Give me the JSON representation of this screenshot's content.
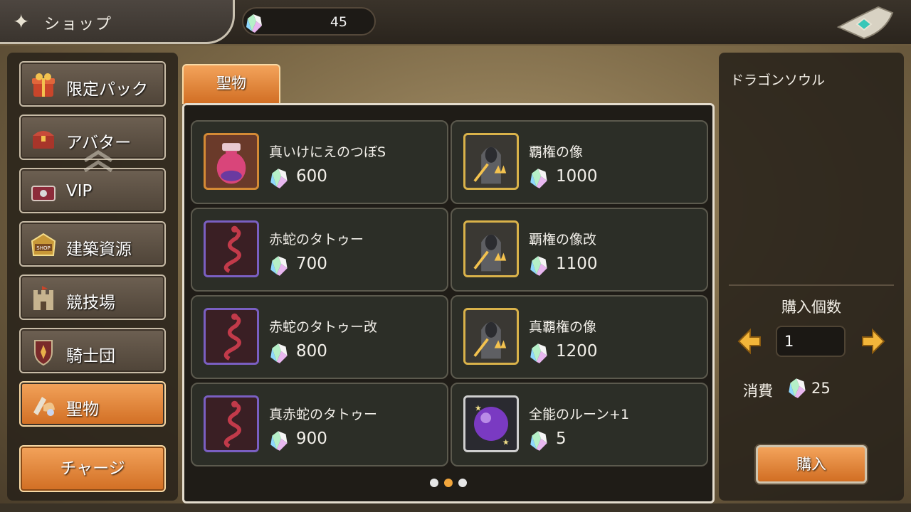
{
  "header": {
    "title": "ショップ",
    "currency_icon": "crystal-gem-icon",
    "currency_value": "45"
  },
  "sidebar": {
    "items": [
      {
        "label": "限定パック",
        "icon": "gift-box-icon",
        "active": false
      },
      {
        "label": "アバター",
        "icon": "treasure-chest-icon",
        "active": false
      },
      {
        "label": "VIP",
        "icon": "vip-chest-icon",
        "active": false
      },
      {
        "label": "建築資源",
        "icon": "shop-sign-icon",
        "active": false
      },
      {
        "label": "競技場",
        "icon": "castle-icon",
        "active": false
      },
      {
        "label": "騎士団",
        "icon": "shield-emblem-icon",
        "active": false
      },
      {
        "label": "聖物",
        "icon": "relic-icon",
        "active": true
      }
    ],
    "charge_label": "チャージ"
  },
  "main": {
    "tab_label": "聖物",
    "items": [
      {
        "name": "真いけにえのつぼS",
        "price": "600",
        "icon": "pot-icon"
      },
      {
        "name": "覇権の像",
        "price": "1000",
        "icon": "statue-icon"
      },
      {
        "name": "赤蛇のタトゥー",
        "price": "700",
        "icon": "snake-tattoo-icon"
      },
      {
        "name": "覇権の像改",
        "price": "1100",
        "icon": "statue-icon"
      },
      {
        "name": "赤蛇のタトゥー改",
        "price": "800",
        "icon": "snake-tattoo-icon"
      },
      {
        "name": "真覇権の像",
        "price": "1200",
        "icon": "statue-icon"
      },
      {
        "name": "真赤蛇のタトゥー",
        "price": "900",
        "icon": "snake-tattoo-icon"
      },
      {
        "name": "全能のルーン+1",
        "price": "5",
        "icon": "rune-orb-icon"
      }
    ],
    "pagination": {
      "pages": 3,
      "current": 2
    }
  },
  "detail": {
    "selected_name": "ドラゴンソウル",
    "quantity_label": "購入個数",
    "quantity_value": "1",
    "cost_label": "消費",
    "cost_value": "25",
    "buy_label": "購入"
  },
  "colors": {
    "accent_orange": "#e0873a",
    "panel_dark": "#2c2e27",
    "gem_cyan": "#9fe6ff"
  }
}
